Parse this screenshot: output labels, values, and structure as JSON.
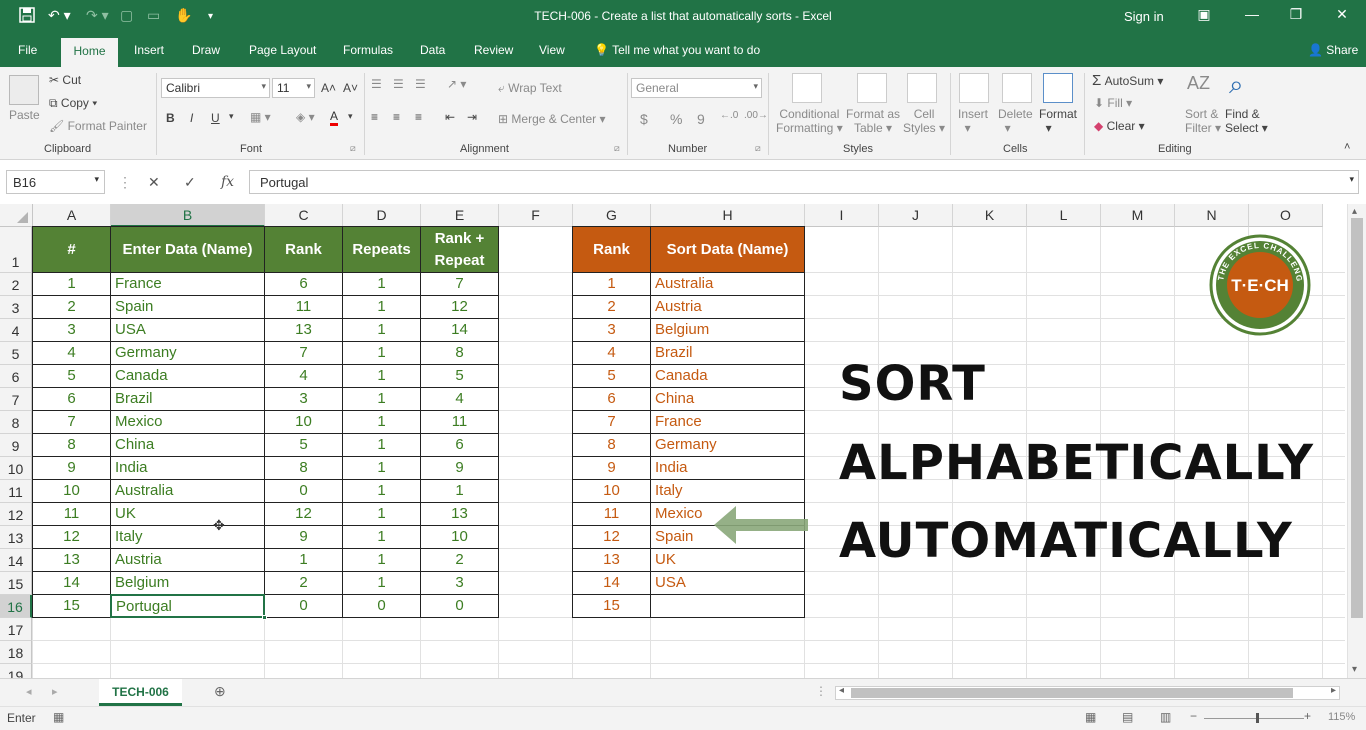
{
  "window": {
    "title": "TECH-006 - Create a list that automatically sorts  -  Excel",
    "signin": "Sign in"
  },
  "tabs": [
    "File",
    "Home",
    "Insert",
    "Draw",
    "Page Layout",
    "Formulas",
    "Data",
    "Review",
    "View"
  ],
  "tellme": "Tell me what you want to do",
  "share": "Share",
  "ribbon": {
    "clipboard": {
      "paste": "Paste",
      "cut": "Cut",
      "copy": "Copy",
      "format_painter": "Format Painter",
      "label": "Clipboard"
    },
    "font": {
      "name": "Calibri",
      "size": "11",
      "bold": "B",
      "italic": "I",
      "underline": "U",
      "label": "Font"
    },
    "alignment": {
      "wrap": "Wrap Text",
      "merge": "Merge & Center",
      "label": "Alignment"
    },
    "number": {
      "format": "General",
      "currency": "$",
      "percent": "%",
      "comma": "9",
      "label": "Number"
    },
    "styles": {
      "conditional": "Conditional",
      "conditional2": "Formatting",
      "format_as": "Format as",
      "format_as2": "Table",
      "cell": "Cell",
      "cell2": "Styles",
      "label": "Styles"
    },
    "cells": {
      "insert": "Insert",
      "delete": "Delete",
      "format": "Format",
      "label": "Cells"
    },
    "editing": {
      "autosum": "AutoSum",
      "fill": "Fill",
      "clear": "Clear",
      "sort": "Sort &",
      "sort2": "Filter",
      "find": "Find &",
      "find2": "Select",
      "label": "Editing"
    }
  },
  "formula_bar": {
    "name_box": "B16",
    "cancel": "✕",
    "enter": "✓",
    "fx": "fx",
    "value": "Portugal"
  },
  "columns": [
    "A",
    "B",
    "C",
    "D",
    "E",
    "F",
    "G",
    "H",
    "I",
    "J",
    "K",
    "L",
    "M",
    "N",
    "O"
  ],
  "rows": [
    "1",
    "2",
    "3",
    "4",
    "5",
    "6",
    "7",
    "8",
    "9",
    "10",
    "11",
    "12",
    "13",
    "14",
    "15",
    "16",
    "17",
    "18",
    "19"
  ],
  "left_table": {
    "headers": [
      "#",
      "Enter Data (Name)",
      "Rank",
      "Repeats",
      "Rank +",
      "Repeat"
    ],
    "rows": [
      [
        "1",
        "France",
        "6",
        "1",
        "7"
      ],
      [
        "2",
        "Spain",
        "11",
        "1",
        "12"
      ],
      [
        "3",
        "USA",
        "13",
        "1",
        "14"
      ],
      [
        "4",
        "Germany",
        "7",
        "1",
        "8"
      ],
      [
        "5",
        "Canada",
        "4",
        "1",
        "5"
      ],
      [
        "6",
        "Brazil",
        "3",
        "1",
        "4"
      ],
      [
        "7",
        "Mexico",
        "10",
        "1",
        "11"
      ],
      [
        "8",
        "China",
        "5",
        "1",
        "6"
      ],
      [
        "9",
        "India",
        "8",
        "1",
        "9"
      ],
      [
        "10",
        "Australia",
        "0",
        "1",
        "1"
      ],
      [
        "11",
        "UK",
        "12",
        "1",
        "13"
      ],
      [
        "12",
        "Italy",
        "9",
        "1",
        "10"
      ],
      [
        "13",
        "Austria",
        "1",
        "1",
        "2"
      ],
      [
        "14",
        "Belgium",
        "2",
        "1",
        "3"
      ],
      [
        "15",
        "Portugal",
        "0",
        "0",
        "0"
      ]
    ]
  },
  "right_table": {
    "headers": [
      "Rank",
      "Sort Data (Name)"
    ],
    "rows": [
      [
        "1",
        "Australia"
      ],
      [
        "2",
        "Austria"
      ],
      [
        "3",
        "Belgium"
      ],
      [
        "4",
        "Brazil"
      ],
      [
        "5",
        "Canada"
      ],
      [
        "6",
        "China"
      ],
      [
        "7",
        "France"
      ],
      [
        "8",
        "Germany"
      ],
      [
        "9",
        "India"
      ],
      [
        "10",
        "Italy"
      ],
      [
        "11",
        "Mexico"
      ],
      [
        "12",
        "Spain"
      ],
      [
        "13",
        "UK"
      ],
      [
        "14",
        "USA"
      ],
      [
        "15",
        ""
      ]
    ]
  },
  "overlay": {
    "line1": "SORT",
    "line2": "ALPHABETICALLY",
    "line3": "AUTOMATICALLY",
    "logo_text": "T·E·CH",
    "logo_ring": "THE EXCEL CHALLENGE"
  },
  "sheet_tab": "TECH-006",
  "status": {
    "mode": "Enter",
    "zoom": "115%"
  },
  "colors": {
    "excel_green": "#217346",
    "header_green": "#548235",
    "header_orange": "#c55a11",
    "logo": "#c55a11"
  }
}
